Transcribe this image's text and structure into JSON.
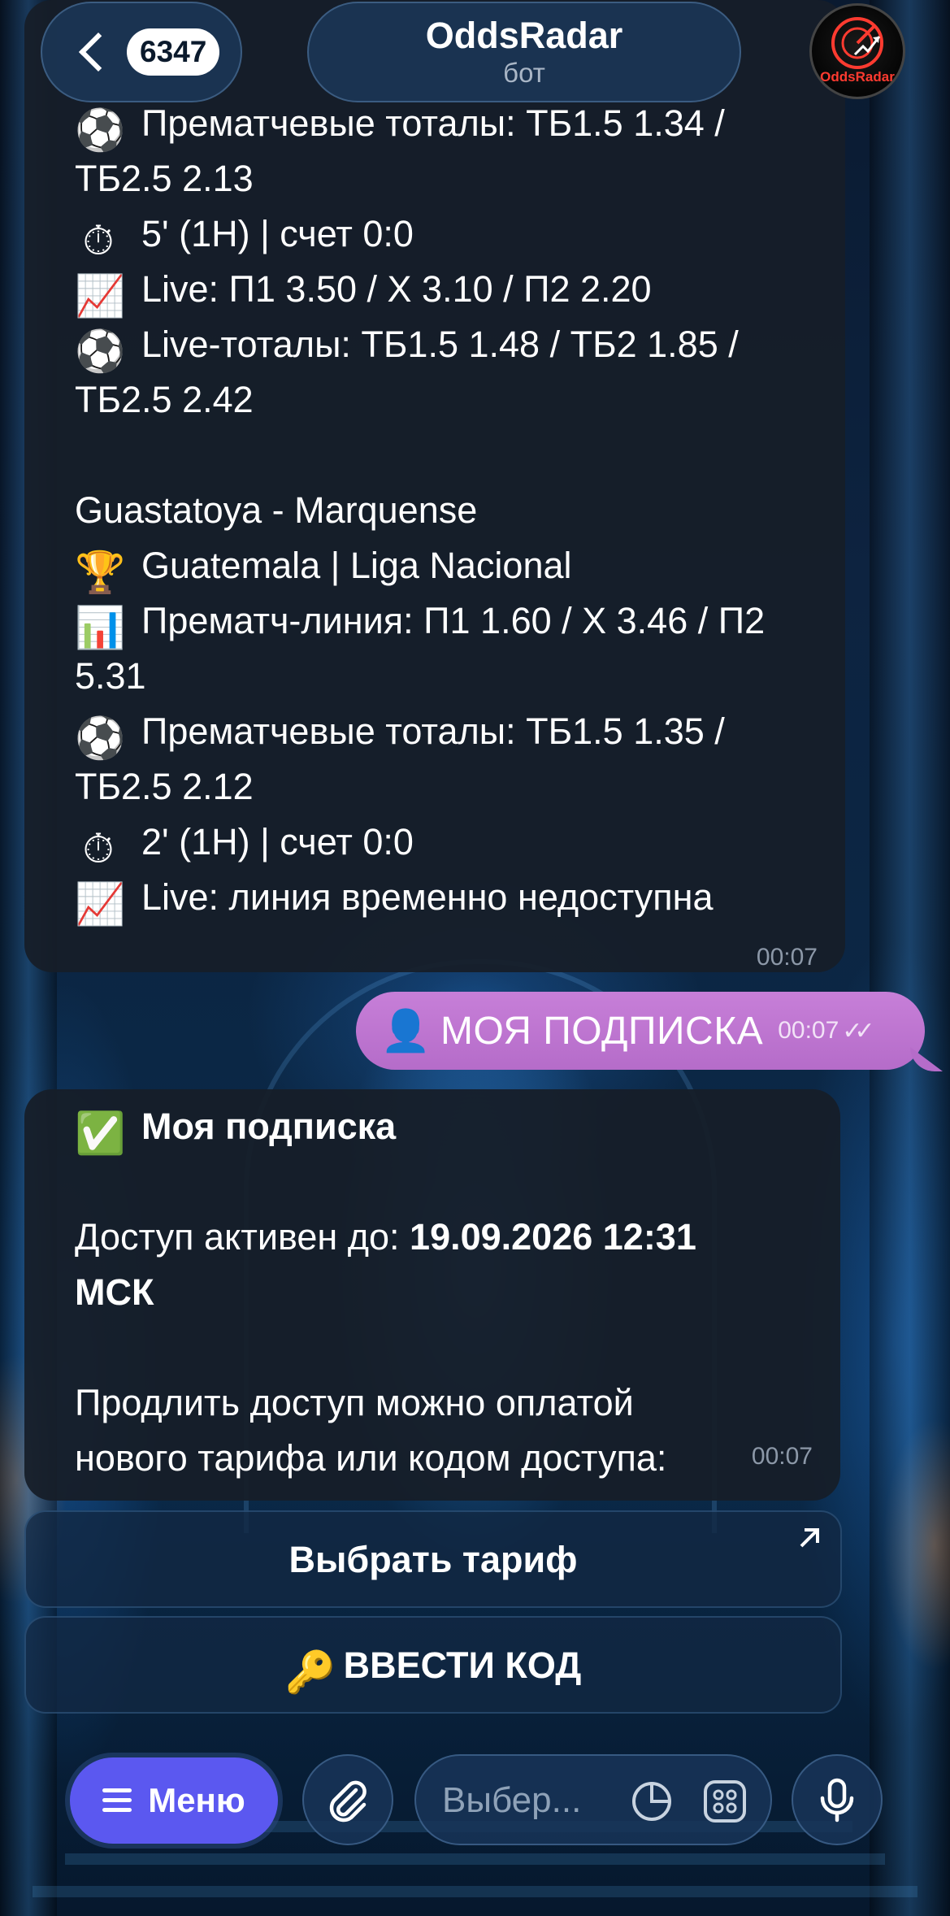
{
  "header": {
    "unread_count": "6347",
    "title": "OddsRadar",
    "subtitle": "бот",
    "avatar_brand": "OddsRadar"
  },
  "messages": {
    "match_update": {
      "lines": [
        {
          "icon": "⚽",
          "text": "Прематчевые тоталы: ТБ1.5 1.34 /"
        },
        {
          "icon": "",
          "text": "ТБ2.5 2.13"
        },
        {
          "icon": "⏱",
          "text": "5' (1H) | счет 0:0"
        },
        {
          "icon": "📈",
          "text": "Live: П1 3.50 / X 3.10 / П2 2.20"
        },
        {
          "icon": "⚽",
          "text": "Live-тоталы: ТБ1.5 1.48 / ТБ2 1.85 /"
        },
        {
          "icon": "",
          "text": "ТБ2.5 2.42"
        },
        {
          "icon": "",
          "text": ""
        },
        {
          "icon": "",
          "text": "Guastatoya - Marquense"
        },
        {
          "icon": "🏆",
          "text": "Guatemala | Liga Nacional"
        },
        {
          "icon": "📊",
          "text": "Прематч-линия: П1 1.60 / X 3.46 / П2"
        },
        {
          "icon": "",
          "text": "5.31"
        },
        {
          "icon": "⚽",
          "text": "Прематчевые тоталы: ТБ1.5 1.35 /"
        },
        {
          "icon": "",
          "text": "ТБ2.5 2.12"
        },
        {
          "icon": "⏱",
          "text": "2' (1H) | счет 0:0"
        },
        {
          "icon": "📈",
          "text": "Live: линия временно недоступна"
        }
      ],
      "time": "00:07"
    },
    "outgoing": {
      "icon": "👤",
      "text": "МОЯ ПОДПИСКА",
      "time": "00:07",
      "status": "✓✓"
    },
    "subscription": {
      "check_icon": "✅",
      "title": "Моя подписка",
      "access_label": "Доступ активен до:",
      "access_date": "19.09.2026 12:31",
      "access_tz": "МСК",
      "renew_line1": "Продлить доступ можно оплатой",
      "renew_line2": "нового тарифа или кодом доступа:",
      "time": "00:07"
    }
  },
  "keyboard": {
    "choose_tariff": "Выбрать тариф",
    "enter_code_icon": "🔑",
    "enter_code": "ВВЕСТИ КОД"
  },
  "composer": {
    "menu_label": "Меню",
    "placeholder": "Выбер..."
  },
  "colors": {
    "outgoing_bubble": "#b56cc9",
    "menu_button": "#5b58f0",
    "incoming_bubble": "#161e28"
  }
}
